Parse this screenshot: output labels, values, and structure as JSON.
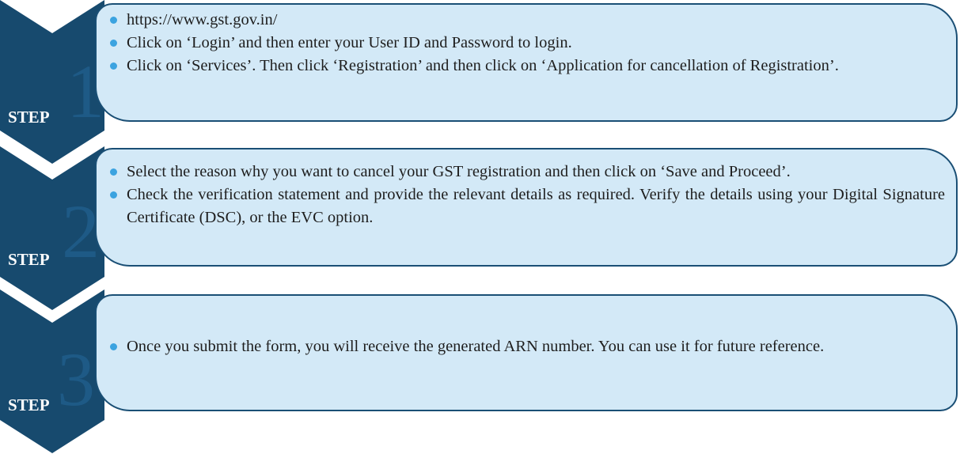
{
  "colors": {
    "chevron": "#174a6e",
    "box_fill": "#d3e9f7",
    "box_border": "#1a4f75",
    "bullet": "#3ba3e0",
    "number": "#1e5a86"
  },
  "steps": [
    {
      "label": "STEP",
      "number": "1",
      "bullets": [
        "https://www.gst.gov.in/",
        "Click on ‘Login’ and then enter your User ID and Password to login.",
        "Click on ‘Services’. Then click ‘Registration’ and then click on ‘Application for cancellation of Registration’."
      ]
    },
    {
      "label": "STEP",
      "number": "2",
      "bullets": [
        "Select the reason why you want to cancel your GST registration and then click on ‘Save and Proceed’.",
        "Check the verification statement and provide the relevant details as required. Verify the details using your Digital Signature Certificate (DSC), or the EVC option."
      ]
    },
    {
      "label": "STEP",
      "number": "3",
      "bullets": [
        "Once you submit the form, you will receive the generated ARN number. You can use it for future reference."
      ]
    }
  ]
}
